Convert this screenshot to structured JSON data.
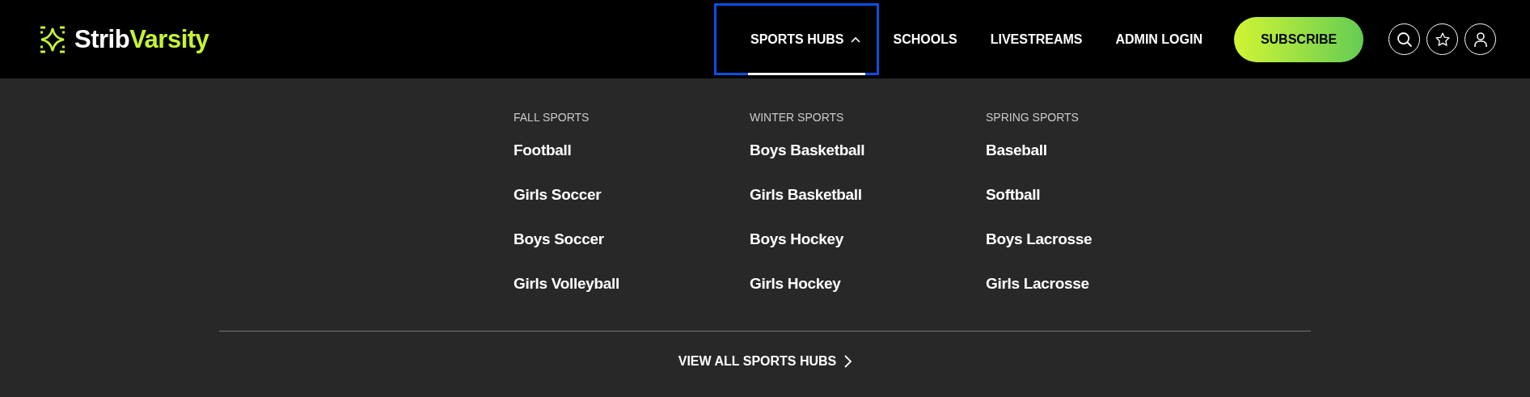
{
  "logo": {
    "part_1": "Strib",
    "part_2": "Varsity"
  },
  "nav": [
    {
      "label": "SPORTS HUBS",
      "selected": true,
      "expanded": true,
      "focused": true,
      "kind": "dropdown"
    },
    {
      "label": "SCHOOLS",
      "selected": false,
      "kind": "link"
    },
    {
      "label": "LIVESTREAMS",
      "selected": false,
      "kind": "link"
    },
    {
      "label": "ADMIN LOGIN",
      "selected": false,
      "kind": "link"
    }
  ],
  "subscribe_button": "SUBSCRIBE",
  "columns": [
    {
      "heading": "FALL SPORTS",
      "items": [
        "Football",
        "Girls Soccer",
        "Boys Soccer",
        "Girls Volleyball"
      ]
    },
    {
      "heading": "WINTER SPORTS",
      "items": [
        "Boys Basketball",
        "Girls Basketball",
        "Boys Hockey",
        "Girls Hockey"
      ]
    },
    {
      "heading": "SPRING SPORTS",
      "items": [
        "Baseball",
        "Softball",
        "Boys Lacrosse",
        "Girls Lacrosse"
      ]
    }
  ],
  "view_all": "VIEW ALL SPORTS HUBS"
}
